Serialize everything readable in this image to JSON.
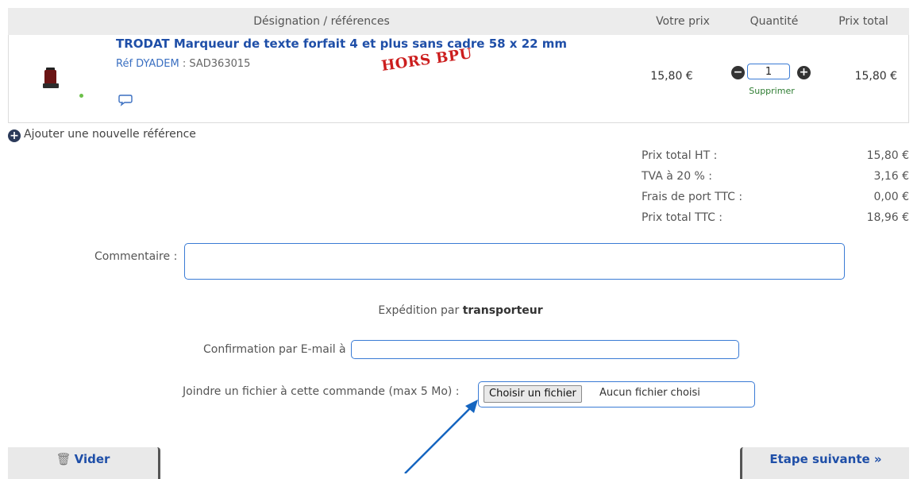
{
  "table": {
    "headers": {
      "designation": "Désignation / références",
      "unit_price": "Votre prix",
      "quantity": "Quantité",
      "total_price": "Prix total"
    }
  },
  "item": {
    "title": "TRODAT Marqueur de texte forfait 4 et plus sans cadre 58 x 22 mm",
    "ref_label": "Réf DYADEM",
    "ref_value": ": SAD363015",
    "stamp": "HORS BPU",
    "unit_price": "15,80 €",
    "quantity": "1",
    "remove_label": "Supprimer",
    "total": "15,80 €"
  },
  "add_reference_label": "Ajouter une nouvelle référence",
  "summary": [
    {
      "label": "Prix total HT :",
      "value": "15,80 €"
    },
    {
      "label": "TVA à 20 % :",
      "value": "3,16 €"
    },
    {
      "label": "Frais de port TTC :",
      "value": "0,00 €"
    },
    {
      "label": "Prix total TTC :",
      "value": "18,96 €"
    }
  ],
  "comment": {
    "label": "Commentaire :"
  },
  "shipping": {
    "prefix": "Expédition par",
    "method": "transporteur"
  },
  "email": {
    "label": "Confirmation par E-mail à",
    "value": ""
  },
  "attachment": {
    "label": "Joindre un fichier à cette commande (max 5 Mo) :",
    "button": "Choisir un fichier",
    "status": "Aucun fichier choisi"
  },
  "buttons": {
    "empty": "Vider",
    "next": "Etape suivante »"
  },
  "icons": {
    "trash": "trash-icon",
    "comment": "speech-bubble-icon",
    "plus": "plus-circle-icon",
    "minus": "minus-circle-icon"
  },
  "colors": {
    "link_blue": "#1f4fa8",
    "stamp_red": "#cc1e1e",
    "field_border": "#3a7bd5",
    "remove_green": "#2e7d32",
    "header_bg": "#ececec"
  }
}
